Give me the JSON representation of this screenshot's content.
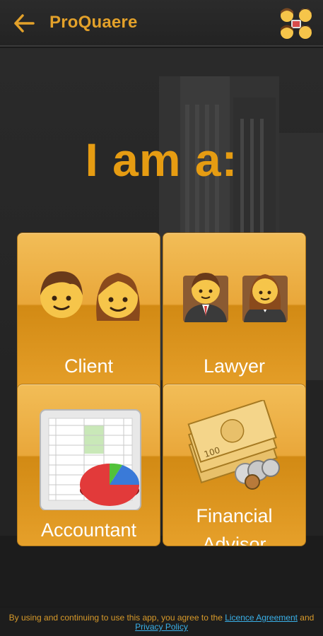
{
  "header": {
    "title": "ProQuaere",
    "back_icon": "arrow-left-icon",
    "profile_icon": "people-group-icon",
    "accent_color": "#e3a12a"
  },
  "main": {
    "heading": "I am a:",
    "tiles": [
      {
        "label": "Client",
        "icon": "man-woman-icon"
      },
      {
        "label": "Lawyer",
        "icon": "business-people-icon"
      },
      {
        "label": "Accountant",
        "icon": "spreadsheet-pie-chart-icon"
      },
      {
        "label_line1": "Financial",
        "label_line2": "Advisor",
        "icon": "money-coins-icon"
      }
    ]
  },
  "footer": {
    "text_before": "By using and continuing to use this app, you agree to the ",
    "licence_link": "Licence Agreement",
    "text_middle": " and ",
    "privacy_link": "Privacy Policy"
  },
  "colors": {
    "tile": "#e9a73a",
    "heading": "#e69c12",
    "link": "#3ab0e8"
  }
}
